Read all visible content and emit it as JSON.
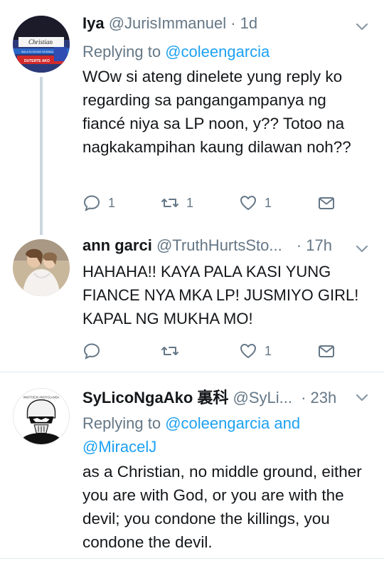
{
  "tweets": [
    {
      "name": "Iya",
      "handle": "@JurisImmanuel",
      "time": "· 1d",
      "replying_prefix": "Replying to",
      "replying_to": "@coleengarcia",
      "text": "WOw si ateng dinelete yung reply ko regarding sa pangangampanya ng fiancé niya sa LP noon, y?? Totoo na nagkakampihan kaung dilawan noh??",
      "reply_count": "1",
      "retweet_count": "1",
      "like_count": "1",
      "avatar_text": {
        "top": "Christian",
        "mid": "WALA SI DIGONG SA BANAL",
        "bottom": "DUTERTE AKO"
      }
    },
    {
      "name": "ann garci",
      "handle": "@TruthHurtsSto...",
      "time": "· 17h",
      "text": "HAHAHA!! KAYA PALA KASI YUNG FIANCE NYA MKA LP! JUSMIYO GIRL! KAPAL NG MUKHA MO!",
      "reply_count": "",
      "retweet_count": "",
      "like_count": "1"
    },
    {
      "name": "SyLicoNgaAko 裏科",
      "handle": "@SyLi...",
      "time": "· 23h",
      "replying_prefix": "Replying to",
      "replying_to": "@coleengarcia and",
      "replying_to_2": "@MiracelJ",
      "text": "as a Christian, no middle ground, either you are with God, or you are with the devil; you condone the killings, you condone the devil.",
      "avatar_text": "#NOTOEJK #NOYOLANDA"
    }
  ],
  "colors": {
    "link": "#1da1f2",
    "secondary": "#657786",
    "divider": "#e1e8ed"
  }
}
